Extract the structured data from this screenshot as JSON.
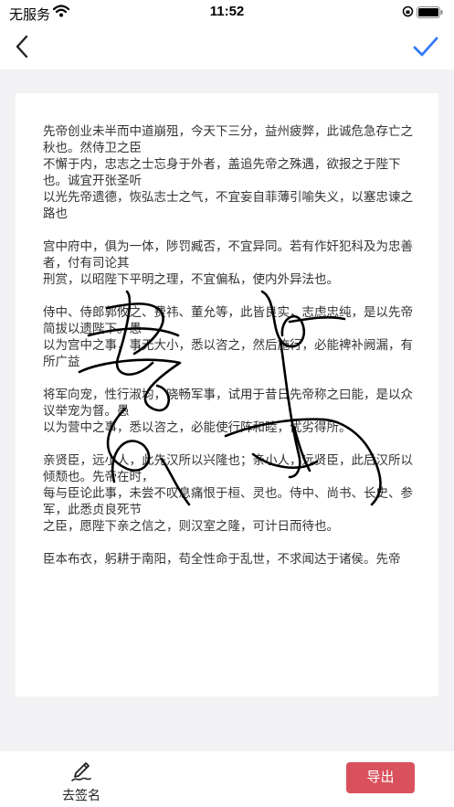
{
  "status_bar": {
    "carrier": "无服务",
    "time": "11:52"
  },
  "nav": {
    "back_icon": "chevron-left-icon",
    "confirm_icon": "checkmark-icon",
    "accent_color": "#3478f6"
  },
  "document": {
    "paragraphs": [
      [
        "先帝创业未半而中道崩殂，今天下三分，益州疲弊，此诚危急存亡之秋也。然侍卫之臣",
        "不懈于内，忠志之士忘身于外者，盖追先帝之殊遇，欲报之于陛下也。诚宜开张圣听",
        "以光先帝遗德，恢弘志士之气，不宜妄自菲薄引喻失义，以塞忠谏之路也"
      ],
      [
        "宫中府中，俱为一体，陟罚臧否，不宜异同。若有作奸犯科及为忠善者，付有司论其",
        "刑赏，以昭陛下平明之理，不宜偏私，使内外异法也。"
      ],
      [
        "侍中、侍郎郭攸之、费祎、董允等，此皆良实，志虑忠纯，是以先帝简拔以遗陛下。愚",
        "以为宫中之事，事无大小，悉以咨之，然后施行，必能裨补阙漏，有所广益"
      ],
      [
        "将军向宠，性行淑均，晓畅军事，试用于昔日先帝称之曰能，是以众议举宠为督。愚",
        "以为营中之事，悉以咨之，必能使行阵和睦，优劣得所。"
      ],
      [
        "亲贤臣，远小人，此先汉所以兴隆也；亲小人，远贤臣，此后汉所以倾颓也。先帝在时，",
        "每与臣论此事，未尝不叹息痛恨于桓、灵也。侍中、尚书、长史、参军，此悉贞良死节",
        "之臣，愿陛下亲之信之，则汉室之隆，可计日而待也。"
      ],
      [
        "臣本布衣，躬耕于南阳，苟全性命于乱世，不求闻达于诸侯。先帝"
      ]
    ]
  },
  "bottom": {
    "sign_icon": "pen-signature-icon",
    "sign_label": "去签名",
    "export_label": "导出",
    "export_color": "#d9515d"
  }
}
